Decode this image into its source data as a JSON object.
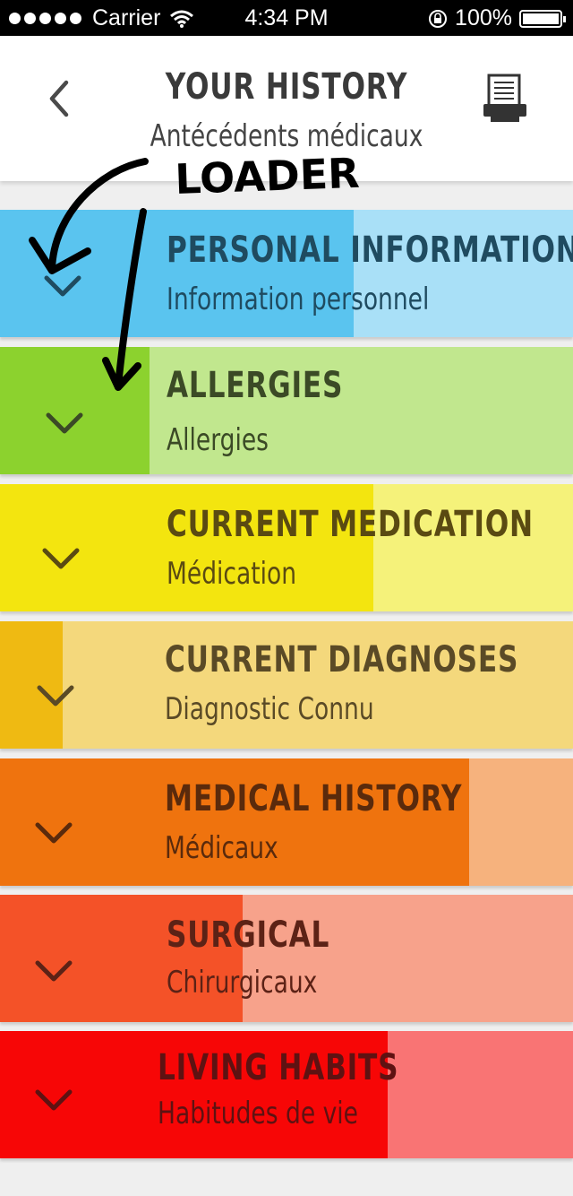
{
  "status_bar": {
    "carrier": "Carrier",
    "time": "4:34 PM",
    "battery": "100%"
  },
  "header": {
    "title": "YOUR HISTORY",
    "subtitle": "Antécédents médicaux",
    "back_icon": "chevron-left-icon",
    "print_icon": "printer-icon"
  },
  "annotation": {
    "text": "LOADER"
  },
  "sections": [
    {
      "title": "PERSONAL INFORMATION",
      "subtitle": "Information personnel",
      "progress": 0.617,
      "fill_color": "#5ac4ef",
      "bg_color": "#a9e0f7",
      "text_color": "#1f4b60"
    },
    {
      "title": "ALLERGIES",
      "subtitle": "Allergies",
      "progress": 0.261,
      "fill_color": "#8cd22e",
      "bg_color": "#c1e78e",
      "text_color": "#3b4a26"
    },
    {
      "title": "CURRENT MEDICATION",
      "subtitle": "Médication",
      "progress": 0.652,
      "fill_color": "#f3e50f",
      "bg_color": "#f5f27a",
      "text_color": "#5a4a12"
    },
    {
      "title": "CURRENT DIAGNOSES",
      "subtitle": "Diagnostic Connu",
      "progress": 0.109,
      "fill_color": "#efba12",
      "bg_color": "#f4d87c",
      "text_color": "#5a4a26"
    },
    {
      "title": "MEDICAL HISTORY",
      "subtitle": "Médicaux",
      "progress": 0.819,
      "fill_color": "#ef730e",
      "bg_color": "#f6b27d",
      "text_color": "#5a2a0c"
    },
    {
      "title": "SURGICAL",
      "subtitle": "Chirurgicaux",
      "progress": 0.423,
      "fill_color": "#f45228",
      "bg_color": "#f7a28b",
      "text_color": "#5c2216"
    },
    {
      "title": "LIVING HABITS",
      "subtitle": "Habitudes de vie",
      "progress": 0.677,
      "fill_color": "#f70606",
      "bg_color": "#f97474",
      "text_color": "#5e1212"
    }
  ]
}
